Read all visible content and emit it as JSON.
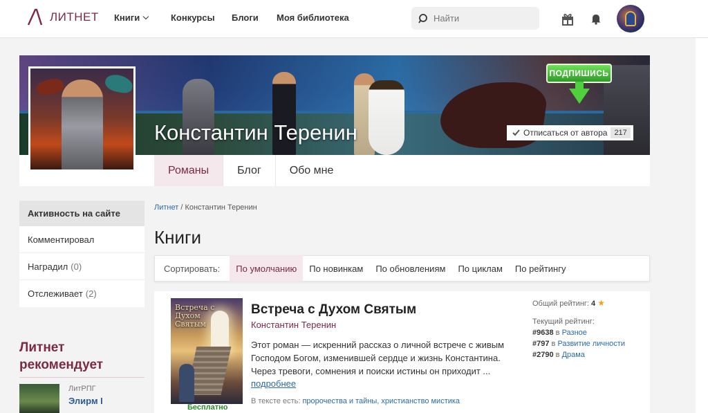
{
  "nav": {
    "logo_text": "ЛИТНЕТ",
    "items": [
      {
        "label": "Книги"
      },
      {
        "label": "Конкурсы"
      },
      {
        "label": "Блоги"
      },
      {
        "label": "Моя библиотека"
      }
    ],
    "search_placeholder": "Найти"
  },
  "profile": {
    "name": "Константин Теренин",
    "subscribe_badge": "ПОДПИШИСЬ",
    "unsubscribe_label": "Отписаться от автора",
    "subscribers": "217",
    "tabs": [
      {
        "label": "Романы",
        "active": true
      },
      {
        "label": "Блог"
      },
      {
        "label": "Обо мне"
      }
    ]
  },
  "sidebar": {
    "activity_title": "Активность на сайте",
    "items": [
      {
        "label": "Комментировал",
        "count": ""
      },
      {
        "label": "Наградил",
        "count": "(0)"
      },
      {
        "label": "Отслеживает",
        "count": "(2)"
      }
    ],
    "recommend_title": "Литнет рекомендует",
    "rec_genre": "ЛитРПГ",
    "rec_book": "Элирм I"
  },
  "main": {
    "breadcrumb_home": "Литнет",
    "breadcrumb_sep": " / ",
    "breadcrumb_current": "Константин Теренин",
    "section_title": "Книги",
    "sort_label": "Сортировать:",
    "sort_options": [
      {
        "label": "По умолчанию",
        "active": true
      },
      {
        "label": "По новинкам"
      },
      {
        "label": "По обновлениям"
      },
      {
        "label": "По циклам"
      },
      {
        "label": "По рейтингу"
      }
    ]
  },
  "book": {
    "cover_title": "Встреча с Духом Святым",
    "price_label": "Бесплатно",
    "title": "Встреча с Духом Святым",
    "author": "Константин Теренин",
    "description": "Этот роман — искренний рассказ о личной встрече с живым Господом Богом, изменившей сердце и жизнь Константина. Через тревоги, сомнения и поиски истины он приходит ...",
    "more_label": "подробнее",
    "tags_prefix": "В тексте есть:",
    "tag1": "пророчества и тайны",
    "tag_sep": ", ",
    "tag2": "христианство мистика",
    "overall_rating_label": "Общий рейтинг:",
    "overall_rating_value": "4",
    "current_rating_label": "Текущий рейтинг:",
    "in_word": "в",
    "rank1": "#9638",
    "rank1_cat": "Разное",
    "rank2": "#797",
    "rank2_cat": "Развитие личности",
    "rank3": "#2790",
    "rank3_cat": "Драма"
  },
  "colors": {
    "brand": "#7a2a44",
    "link": "#2a6aa8",
    "active_bg": "#f4e8ec",
    "badge_green": "#2f9a2a"
  },
  "icons": [
    "search-icon",
    "gift-icon",
    "bell-icon",
    "check-icon",
    "star-icon",
    "chevron-down-icon"
  ]
}
